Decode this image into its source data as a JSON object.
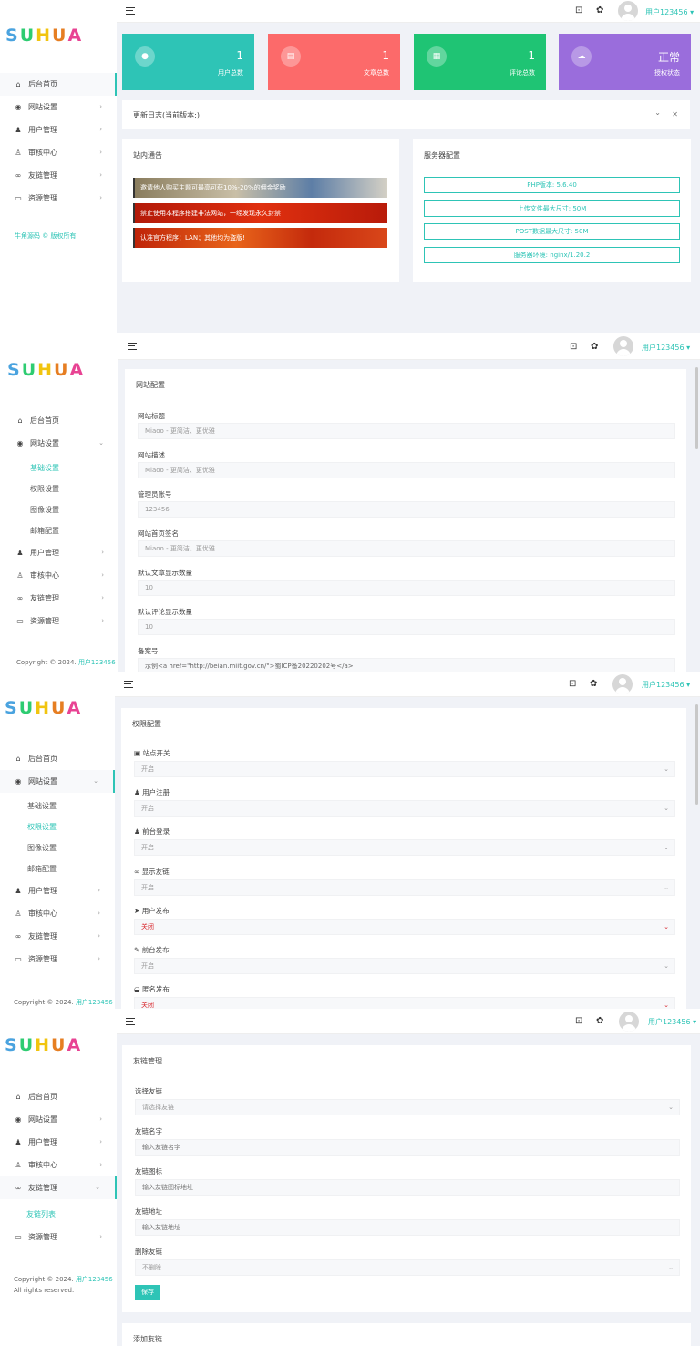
{
  "brand": {
    "letters": [
      "S",
      "U",
      "H",
      "U",
      "A"
    ],
    "colors": [
      "#4aa3df",
      "#2ecc71",
      "#f1c40f",
      "#e67e22",
      "#e84393"
    ]
  },
  "user": {
    "name": "用户123456",
    "caret": "▾"
  },
  "accent": "#2ec4b6",
  "sidebar": {
    "home": "后台首页",
    "site": "网站设置",
    "users": "用户管理",
    "audit": "审核中心",
    "links": "友链管理",
    "resources": "资源管理",
    "sub_basic": "基础设置",
    "sub_perm": "权限设置",
    "sub_image": "图像设置",
    "sub_mail": "邮箱配置",
    "sub_linklist": "友链列表"
  },
  "footer": {
    "s1_brand": "牛角源码",
    "s1_rights": "© 版权所有",
    "copyright": "Copyright © 2024.",
    "rights": "All rights reserved."
  },
  "dashboard": {
    "stats": [
      {
        "value": "1",
        "label": "用户总数",
        "icon": "user-icon",
        "color": "#2ec4b6"
      },
      {
        "value": "1",
        "label": "文章总数",
        "icon": "document-icon",
        "color": "#fc6a6a"
      },
      {
        "value": "1",
        "label": "评论总数",
        "icon": "comment-icon",
        "color": "#1fc474"
      },
      {
        "value": "正常",
        "label": "授权状态",
        "icon": "cloud-icon",
        "color": "#9a6ddc"
      }
    ],
    "changelog_title": "更新日志(当前版本:)",
    "notice_title": "站内通告",
    "notices": [
      "邀请他人购买主题可最高可获10%-20%的佣金奖励",
      "禁止使用本程序搭建非法网站，一经发现永久封禁",
      "认准官方程序：LAN；其他均为盗版!"
    ],
    "server_title": "服务器配置",
    "server": [
      "PHP版本: 5.6.40",
      "上传文件最大尺寸: 50M",
      "POST数据最大尺寸: 50M",
      "服务器环境: nginx/1.20.2"
    ]
  },
  "site_config": {
    "title": "网站配置",
    "fields": [
      {
        "label": "网站标题",
        "value": "Miaoo - 更简洁、更优雅"
      },
      {
        "label": "网站描述",
        "value": "Miaoo - 更简洁、更优雅"
      },
      {
        "label": "管理员账号",
        "value": "123456"
      },
      {
        "label": "网站首页签名",
        "value": "Miaoo - 更简洁、更优雅"
      },
      {
        "label": "默认文章显示数量",
        "value": "10"
      },
      {
        "label": "默认评论显示数量",
        "value": "10"
      },
      {
        "label": "备案号",
        "value": "示例<a href=\"http://beian.miit.gov.cn/\">蜀ICP备20220202号</a>"
      }
    ]
  },
  "perm_config": {
    "title": "权限配置",
    "fields": [
      {
        "label": "站点开关",
        "value": "开启",
        "icon": "site-icon"
      },
      {
        "label": "用户注册",
        "value": "开启",
        "icon": "user-add-icon"
      },
      {
        "label": "前台登录",
        "value": "开启",
        "icon": "login-icon"
      },
      {
        "label": "显示友链",
        "value": "开启",
        "icon": "link-icon"
      },
      {
        "label": "用户发布",
        "value": "关闭",
        "icon": "send-icon"
      },
      {
        "label": "前台发布",
        "value": "开启",
        "icon": "pen-icon"
      },
      {
        "label": "匿名发布",
        "value": "关闭",
        "icon": "anon-icon"
      }
    ]
  },
  "link_config": {
    "title": "友链管理",
    "fields": [
      {
        "label": "选择友链",
        "value": "请选择友链"
      },
      {
        "label": "友链名字",
        "value": "输入友链名字"
      },
      {
        "label": "友链图标",
        "value": "输入友链图标地址"
      },
      {
        "label": "友链地址",
        "value": "输入友链地址"
      },
      {
        "label": "删除友链",
        "value": "不删除"
      }
    ],
    "save": "保存",
    "add_title": "添加友链"
  }
}
